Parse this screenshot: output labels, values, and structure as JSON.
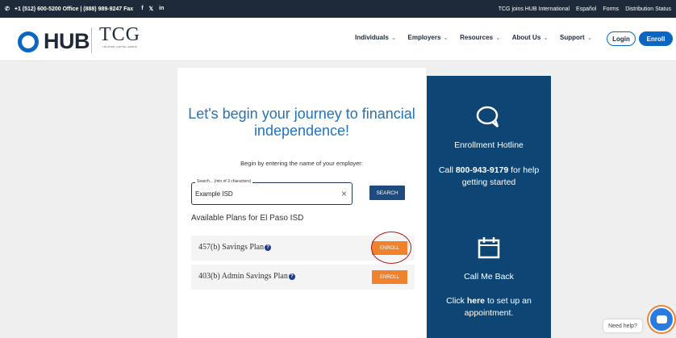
{
  "topbar": {
    "phone_info": "+1 (512) 600-5200 Office | (888) 989-9247 Fax",
    "social": [
      "f",
      "𝕏",
      "in"
    ],
    "links": [
      "TCG joins HUB International",
      "Español",
      "Forms",
      "Distribution Status"
    ]
  },
  "header": {
    "hub_logo": "HUB",
    "tcg_logo": "TCG",
    "tcg_sub": "TRUSTED CAPITAL GROUP",
    "nav": [
      {
        "label": "Individuals",
        "chevron": "⌄"
      },
      {
        "label": "Employers",
        "chevron": "⌄"
      },
      {
        "label": "Resources",
        "chevron": "⌄"
      },
      {
        "label": "About Us",
        "chevron": "⌄"
      },
      {
        "label": "Support",
        "chevron": "⌄"
      }
    ],
    "login_label": "Login",
    "enroll_label": "Enroll"
  },
  "main": {
    "heading": "Let's begin your journey to financial independence!",
    "subheading": "Begin by entering the name of your employer:",
    "search": {
      "label": "Search... (min of 3 characters)",
      "value": "Example ISD",
      "clear": "×",
      "button": "SEARCH"
    },
    "available_title": "Available Plans for El Paso ISD",
    "plans": [
      {
        "name": "457(b) Savings Plan",
        "button": "ENROLL",
        "help_icon": "?"
      },
      {
        "name": "403(b) Admin Savings Plan",
        "button": "ENROLL",
        "help_icon": "?"
      }
    ]
  },
  "panel": {
    "hotline_title": "Enrollment Hotline",
    "hotline_pre": "Call ",
    "hotline_number": "800-943-9179",
    "hotline_post": " for help getting started",
    "callme_title": "Call Me Back",
    "callme_pre": "Click ",
    "callme_link": "here",
    "callme_post": " to set up an appointment."
  },
  "help": {
    "label": "Need help?"
  },
  "colors": {
    "accent_blue": "#0a66c2",
    "panel_blue": "#0d4575",
    "enroll_orange": "#f0822e",
    "highlight_ring": "#b31b1b"
  }
}
